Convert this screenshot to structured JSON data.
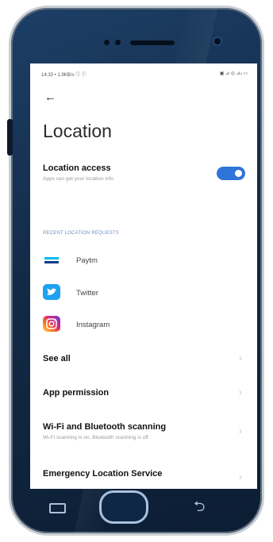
{
  "status_bar": {
    "left": "14:33 • 1.9KB/s ⓘ ⓘ",
    "right": "▣ ⊿ ◎ ⊿ᵢₗ ▭"
  },
  "header": {
    "back_glyph": "←",
    "title": "Location"
  },
  "location_access": {
    "title": "Location access",
    "subtitle": "Apps can get your location info",
    "toggle_on": true
  },
  "recent": {
    "heading": "RECENT LOCATION REQUESTS",
    "apps": [
      {
        "name": "Paytm",
        "icon": "paytm-icon",
        "color": "#0b3b8c"
      },
      {
        "name": "Twitter",
        "icon": "twitter-icon",
        "color": "#1da1f2"
      },
      {
        "name": "Instagram",
        "icon": "instagram-icon",
        "color": "#d62976"
      }
    ]
  },
  "menu": {
    "see_all": "See all",
    "app_permission": "App permission",
    "wifi_scanning": {
      "title": "Wi-Fi and Bluetooth scanning",
      "subtitle": "Wi-Fi scanning is on, Bluetooth scanning is off"
    },
    "emergency": "Emergency Location Service"
  },
  "colors": {
    "accent": "#2f74d8",
    "section": "#6f8fc4",
    "phone_body": "#163556"
  }
}
